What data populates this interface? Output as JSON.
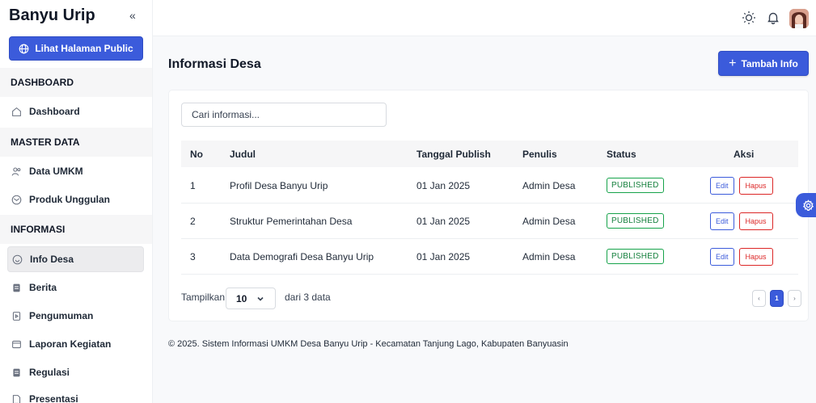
{
  "sidebar": {
    "brand": "Banyu Urip",
    "collapse_glyph": "«",
    "public_button": "Lihat Halaman Public",
    "sections": {
      "dashboard": "DASHBOARD",
      "master_data": "MASTER DATA",
      "informasi": "INFORMASI"
    },
    "items": {
      "dashboard": "Dashboard",
      "data_umkm": "Data UMKM",
      "produk_unggulan": "Produk Unggulan",
      "info_desa": "Info Desa",
      "berita": "Berita",
      "pengumuman": "Pengumuman",
      "laporan_kegiatan": "Laporan Kegiatan",
      "regulasi": "Regulasi",
      "presentasi": "Presentasi"
    },
    "active_item": "info_desa"
  },
  "topbar": {
    "icons": [
      "sun-icon",
      "bell-icon",
      "user-avatar"
    ]
  },
  "main": {
    "title": "Informasi Desa",
    "add_button": "Tambah Info",
    "search": {
      "value": "",
      "placeholder": "Cari informasi..."
    },
    "table": {
      "headers": {
        "no": "No",
        "judul": "Judul",
        "tanggal": "Tanggal Publish",
        "penulis": "Penulis",
        "status": "Status",
        "aksi": "Aksi"
      },
      "rows": [
        {
          "no": "1",
          "judul": "Profil Desa Banyu Urip",
          "tanggal": "01 Jan 2025",
          "penulis": "Admin Desa",
          "status": "PUBLISHED",
          "edit": "Edit",
          "hapus": "Hapus"
        },
        {
          "no": "2",
          "judul": "Struktur Pemerintahan Desa",
          "tanggal": "01 Jan 2025",
          "penulis": "Admin Desa",
          "status": "PUBLISHED",
          "edit": "Edit",
          "hapus": "Hapus"
        },
        {
          "no": "3",
          "judul": "Data Demografi Desa Banyu Urip",
          "tanggal": "01 Jan 2025",
          "penulis": "Admin Desa",
          "status": "PUBLISHED",
          "edit": "Edit",
          "hapus": "Hapus"
        }
      ]
    },
    "pagination": {
      "show_label": "Tampilkan",
      "page_size": "10",
      "total_label": "dari 3 data",
      "prev": "‹",
      "current_page": "1",
      "next": "›"
    }
  },
  "footer": {
    "copyright": "© 2025. Sistem Informasi UMKM Desa Banyu Urip - Kecamatan Tanjung Lago, Kabupaten Banyuasin"
  },
  "colors": {
    "primary": "#3b5bdb",
    "published": "#16a34a",
    "danger": "#dc2626",
    "section_bg": "#f6f6f7"
  }
}
